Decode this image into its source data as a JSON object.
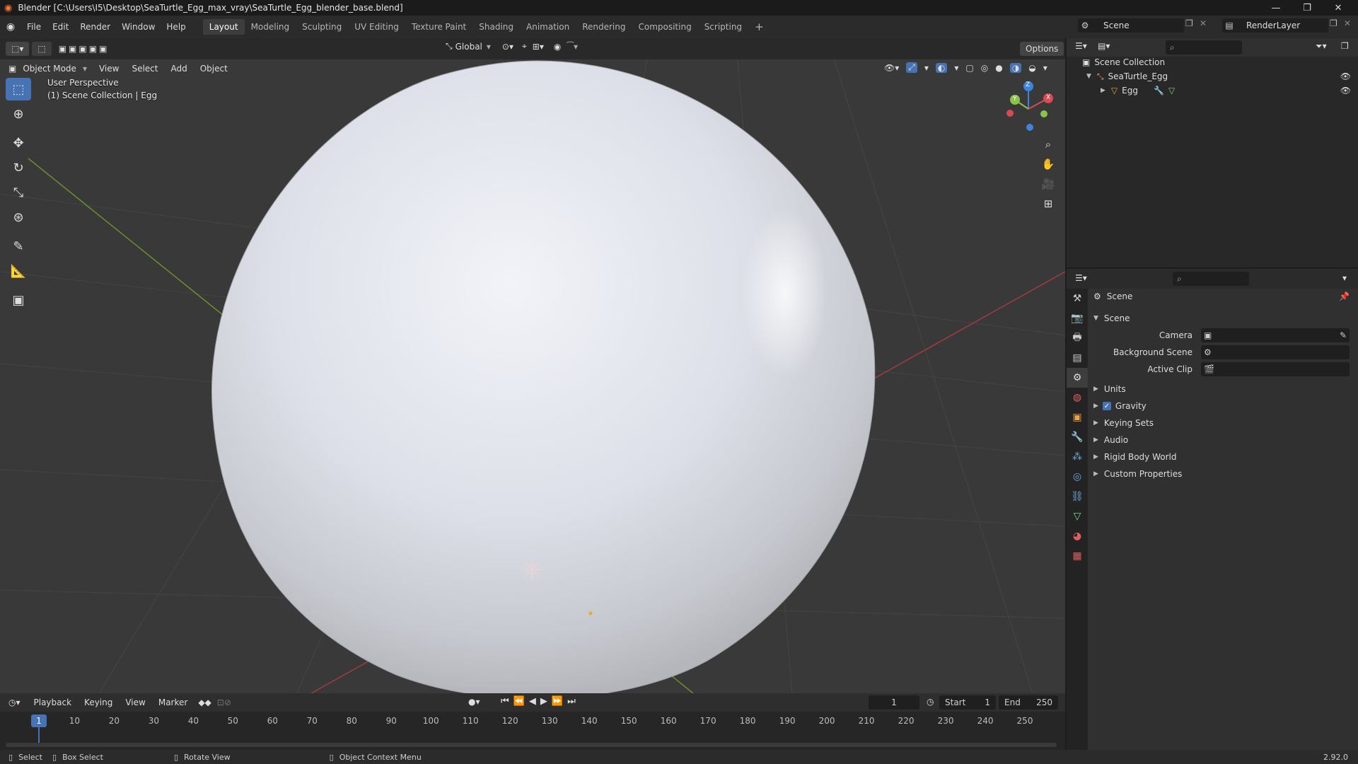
{
  "window": {
    "title": "Blender [C:\\Users\\I5\\Desktop\\SeaTurtle_Egg_max_vray\\SeaTurtle_Egg_blender_base.blend]",
    "minimize": "—",
    "maximize": "❐",
    "close": "✕"
  },
  "menu": [
    "File",
    "Edit",
    "Render",
    "Window",
    "Help"
  ],
  "workspaces": [
    {
      "label": "Layout",
      "active": true
    },
    {
      "label": "Modeling"
    },
    {
      "label": "Sculpting"
    },
    {
      "label": "UV Editing"
    },
    {
      "label": "Texture Paint"
    },
    {
      "label": "Shading"
    },
    {
      "label": "Animation"
    },
    {
      "label": "Rendering"
    },
    {
      "label": "Compositing"
    },
    {
      "label": "Scripting"
    }
  ],
  "add_workspace": "+",
  "scene_selector": "Scene",
  "renderlayer_selector": "RenderLayer",
  "viewport": {
    "transform_orientation": "Global",
    "options": "Options",
    "mode": "Object Mode",
    "header_menus": [
      "View",
      "Select",
      "Add",
      "Object"
    ],
    "overlay_line1": "User Perspective",
    "overlay_line2": "(1) Scene Collection | Egg",
    "gizmo": {
      "z": "Z",
      "y": "Y",
      "x": "X"
    }
  },
  "outliner": {
    "root": "Scene Collection",
    "items": [
      {
        "label": "SeaTurtle_Egg",
        "depth": 1
      },
      {
        "label": "Egg",
        "depth": 2
      }
    ]
  },
  "properties": {
    "context": "Scene",
    "panel": "Scene",
    "fields": [
      {
        "label": "Camera"
      },
      {
        "label": "Background Scene"
      },
      {
        "label": "Active Clip"
      }
    ],
    "sections": [
      {
        "label": "Units",
        "checkbox": false
      },
      {
        "label": "Gravity",
        "checkbox": true
      },
      {
        "label": "Keying Sets",
        "checkbox": false
      },
      {
        "label": "Audio",
        "checkbox": false
      },
      {
        "label": "Rigid Body World",
        "checkbox": false
      },
      {
        "label": "Custom Properties",
        "checkbox": false
      }
    ]
  },
  "timeline": {
    "menus": [
      "Playback",
      "Keying",
      "View",
      "Marker"
    ],
    "current_frame": "1",
    "start_label": "Start",
    "start": "1",
    "end_label": "End",
    "end": "250",
    "ticks": [
      "10",
      "20",
      "30",
      "40",
      "50",
      "60",
      "70",
      "80",
      "90",
      "100",
      "110",
      "120",
      "130",
      "140",
      "150",
      "160",
      "170",
      "180",
      "190",
      "200",
      "210",
      "220",
      "230",
      "240",
      "250"
    ],
    "playhead": "1"
  },
  "statusbar": {
    "select": "Select",
    "box_select": "Box Select",
    "rotate_view": "Rotate View",
    "context_menu": "Object Context Menu",
    "version": "2.92.0"
  },
  "colors": {
    "accent": "#4772b3",
    "x_axis": "#d94a55",
    "y_axis": "#8bc34a",
    "z_axis": "#3a85e0"
  }
}
